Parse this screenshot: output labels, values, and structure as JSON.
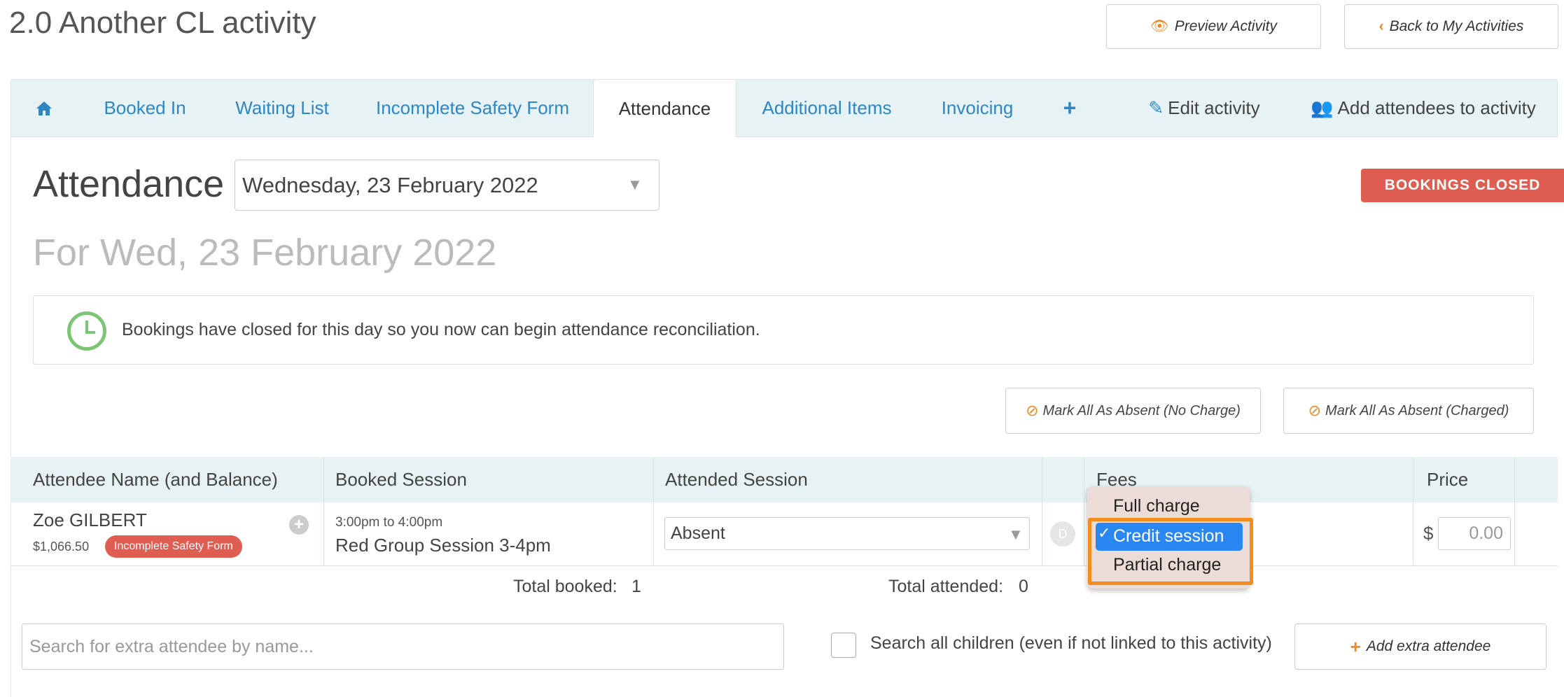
{
  "header": {
    "title": "2.0 Another CL activity",
    "preview_label": "Preview Activity",
    "back_label": "Back to My Activities"
  },
  "tabs": {
    "booked_in": "Booked In",
    "waiting_list": "Waiting List",
    "incomplete_safety": "Incomplete Safety Form",
    "attendance": "Attendance",
    "additional_items": "Additional Items",
    "invoicing": "Invoicing",
    "edit_activity": "Edit activity",
    "add_attendees": "Add attendees to activity"
  },
  "attendance": {
    "heading": "Attendance",
    "date_value": "Wednesday, 23 February 2022",
    "status_badge": "BOOKINGS CLOSED",
    "subtitle": "For Wed, 23 February 2022",
    "alert_text": "Bookings have closed for this day so you now can begin attendance reconciliation.",
    "mark_absent_no_charge": "Mark All As Absent (No Charge)",
    "mark_absent_charged": "Mark All As Absent (Charged)"
  },
  "table": {
    "headers": {
      "name": "Attendee Name (and Balance)",
      "booked": "Booked Session",
      "attended": "Attended Session",
      "fees": "Fees",
      "price": "Price"
    },
    "rows": [
      {
        "name": "Zoe GILBERT",
        "balance": "$1,066.50",
        "badge": "Incomplete Safety Form",
        "session_time": "3:00pm to 4:00pm",
        "session_name": "Red Group Session 3-4pm",
        "attended_value": "Absent",
        "d_label": "D",
        "currency": "$",
        "price": "0.00"
      }
    ],
    "total_booked_label": "Total booked:",
    "total_booked": "1",
    "total_attended_label": "Total attended:",
    "total_attended": "0"
  },
  "fees_dropdown": {
    "options": [
      "Full charge",
      "Credit session",
      "Partial charge"
    ],
    "selected": "Credit session"
  },
  "footer": {
    "search_placeholder": "Search for extra attendee by name...",
    "search_all_label": "Search all children (even if not linked to this activity)",
    "add_extra_label": "Add extra attendee"
  },
  "colors": {
    "accent_orange": "#f08a24",
    "link_blue": "#2f86c5",
    "badge_red": "#e05d52",
    "tab_bg": "#e6f2f3"
  }
}
